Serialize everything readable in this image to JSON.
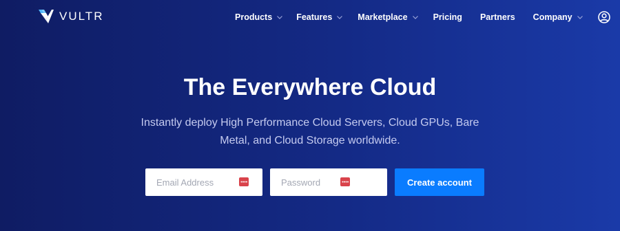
{
  "header": {
    "logo_text": "VULTR",
    "logo_icon": "vultr-v-logo-icon",
    "nav": [
      {
        "label": "Products",
        "has_dropdown": true
      },
      {
        "label": "Features",
        "has_dropdown": true
      },
      {
        "label": "Marketplace",
        "has_dropdown": true
      },
      {
        "label": "Pricing",
        "has_dropdown": false
      },
      {
        "label": "Partners",
        "has_dropdown": false
      },
      {
        "label": "Company",
        "has_dropdown": true
      }
    ],
    "account_icon": "user-circle-icon"
  },
  "hero": {
    "title": "The Everywhere Cloud",
    "subtitle": "Instantly deploy High Performance Cloud Servers, Cloud GPUs, Bare Metal, and Cloud Storage worldwide."
  },
  "signup": {
    "email_placeholder": "Email Address",
    "email_value": "",
    "password_placeholder": "Password",
    "password_value": "",
    "field_icon": "password-manager-icon",
    "button_label": "Create account"
  },
  "colors": {
    "background_start": "#0f1c63",
    "background_end": "#1a3aa8",
    "button": "#0a7cff",
    "subtitle_text": "#c5cbf0",
    "field_icon": "#d9434b"
  }
}
